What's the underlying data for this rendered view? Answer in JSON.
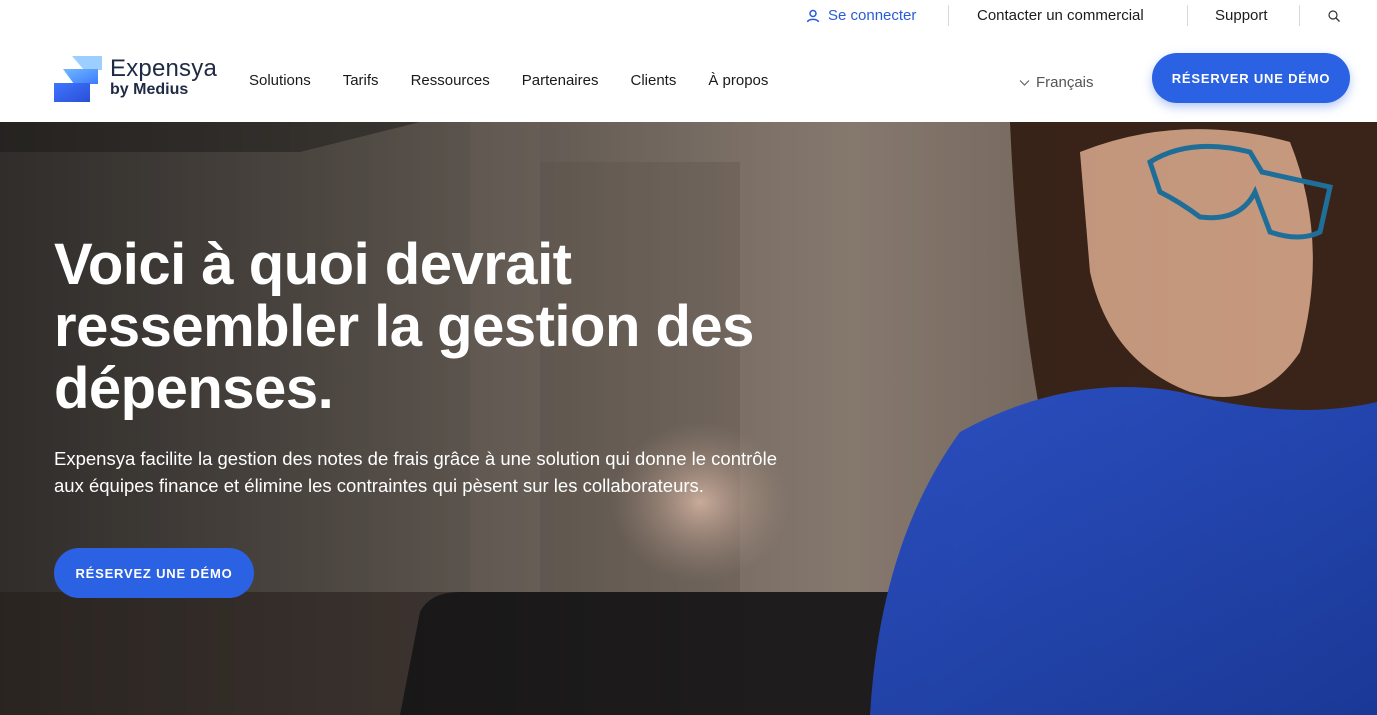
{
  "topbar": {
    "login": "Se connecter",
    "contact": "Contacter un commercial",
    "support": "Support",
    "login_icon": "user-icon",
    "search_icon": "search-icon"
  },
  "header": {
    "logo": {
      "name": "Expensya",
      "sub": "by Medius"
    },
    "nav": [
      "Solutions",
      "Tarifs",
      "Ressources",
      "Partenaires",
      "Clients",
      "À propos"
    ],
    "language": "Français",
    "language_icon": "chevron-down-icon",
    "cta": "RÉSERVER UNE DÉMO"
  },
  "hero": {
    "title": "Voici à quoi devrait ressembler la gestion des dépenses.",
    "description": "Expensya facilite la gestion des notes de frais grâce à une solution qui donne le contrôle aux équipes finance et élimine les contraintes qui pèsent sur les collaborateurs.",
    "cta": "RÉSERVEZ UNE DÉMO"
  },
  "colors": {
    "accent": "#2b62e3",
    "login_link": "#2a5bd7",
    "logo_text": "#1f2a44"
  }
}
